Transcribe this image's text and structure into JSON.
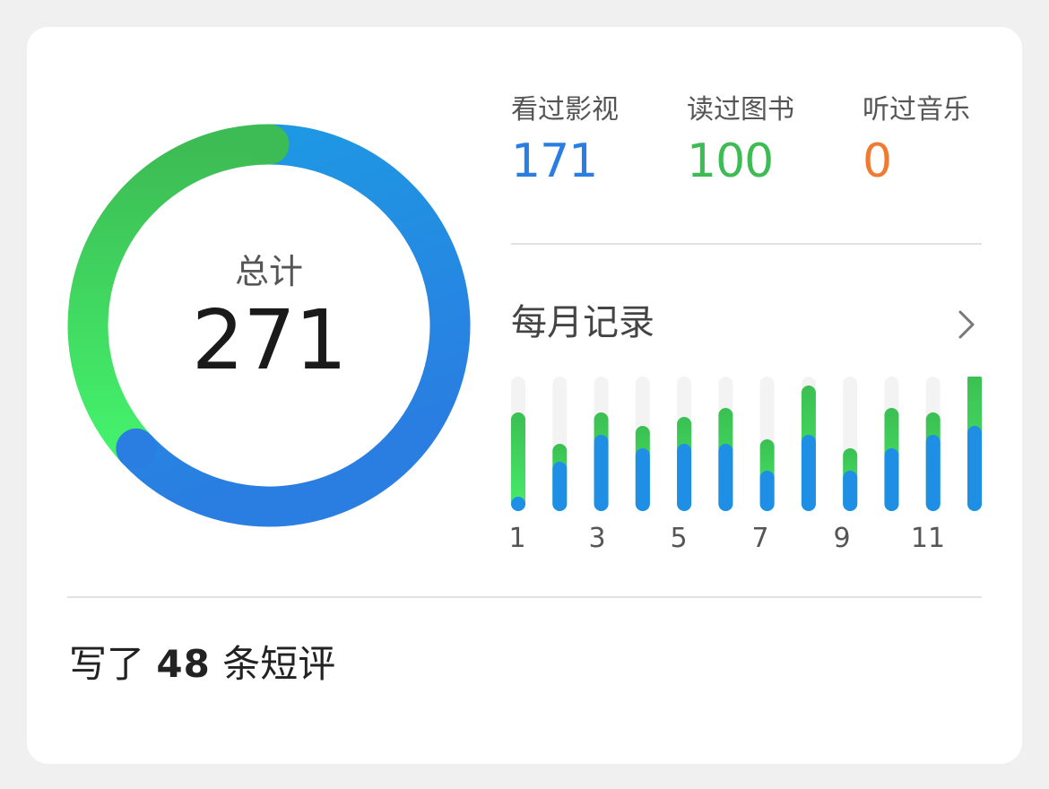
{
  "summary": {
    "total_label": "总计",
    "total_value": "271"
  },
  "stats": [
    {
      "label": "看过影视",
      "value": "171",
      "color": "#2a7de1"
    },
    {
      "label": "读过图书",
      "value": "100",
      "color": "#3dbb54"
    },
    {
      "label": "听过音乐",
      "value": "0",
      "color": "#f07a32"
    }
  ],
  "donut": {
    "segments": [
      {
        "name": "看过影视",
        "value": 171,
        "colors": [
          "#1d9be3",
          "#2a7de1"
        ]
      },
      {
        "name": "读过图书",
        "value": 100,
        "colors": [
          "#44f26c",
          "#3dbb54"
        ]
      }
    ],
    "track_color": "#eeeeee"
  },
  "monthly": {
    "title": "每月记录",
    "chevron_icon": "chevron-right-icon",
    "tick_labels": [
      "1",
      "3",
      "5",
      "7",
      "9",
      "11"
    ]
  },
  "chart_data": {
    "type": "bar",
    "stacked": true,
    "categories": [
      "1",
      "2",
      "3",
      "4",
      "5",
      "6",
      "7",
      "8",
      "9",
      "10",
      "11",
      "12"
    ],
    "ylim": [
      0,
      30
    ],
    "series": [
      {
        "values": [
          1,
          11,
          17,
          14,
          15,
          15,
          9,
          17,
          9,
          14,
          17,
          19
        ],
        "color": "#1f8fe6"
      },
      {
        "values": [
          21,
          4,
          5,
          5,
          6,
          8,
          7,
          11,
          5,
          9,
          5,
          12
        ],
        "color": "#3fd35e"
      }
    ]
  },
  "reviews": {
    "prefix": "写了",
    "count": "48",
    "suffix": "条短评"
  }
}
